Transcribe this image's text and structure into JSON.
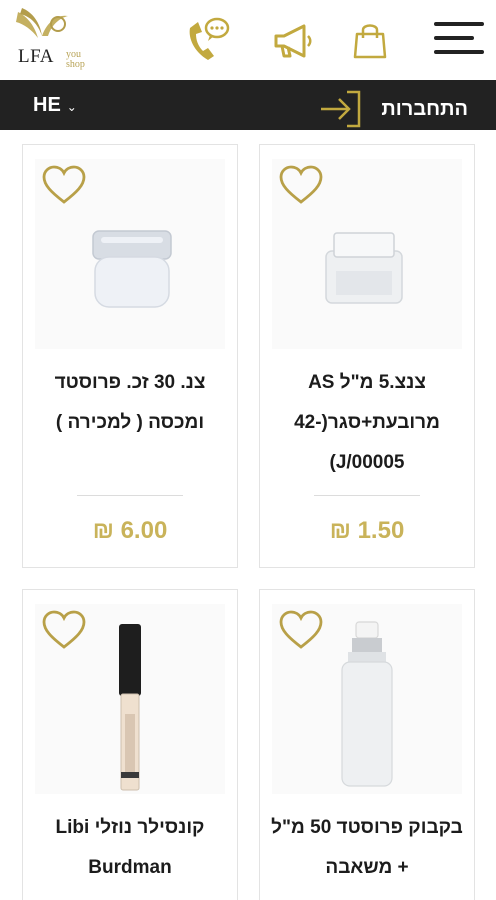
{
  "header": {
    "logo_text": "LFA",
    "logo_sub_top": "you",
    "logo_sub_bottom": "shop",
    "icons": [
      "menu-icon",
      "shopping-bag-icon",
      "megaphone-icon",
      "phone-chat-icon"
    ]
  },
  "bar": {
    "login_label": "התחברות",
    "language": "HE"
  },
  "colors": {
    "gold": "#c9b35a",
    "dark_bar": "#222222"
  },
  "products": [
    {
      "title": "צנצ.5 מ\"ל AS מרובעת+סגר(-42 J/00005)",
      "price": "₪ 1.50"
    },
    {
      "title": "צנ. 30 זכ. פרוסטד ומכסה ( למכירה )",
      "price": "₪ 6.00"
    },
    {
      "title": "בקבוק פרוסטד 50 מ\"ל + משאבה",
      "price": ""
    },
    {
      "title": "קונסילר נוזלי Libi Burdman",
      "price": ""
    }
  ]
}
